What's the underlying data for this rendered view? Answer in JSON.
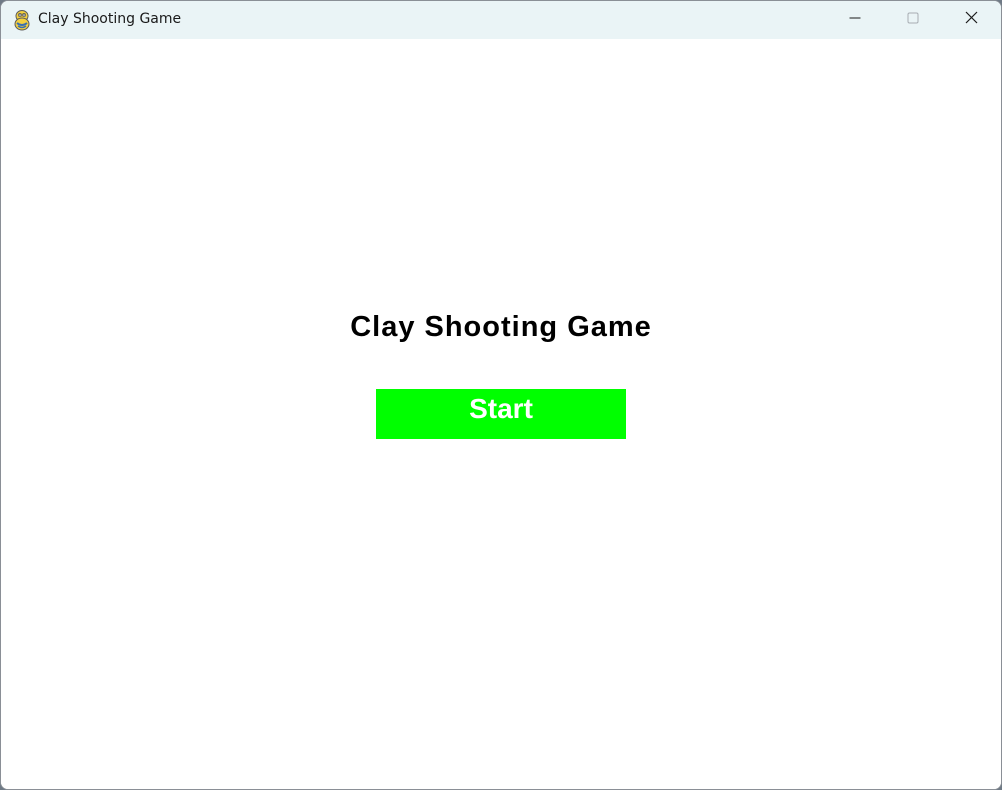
{
  "window": {
    "title": "Clay Shooting Game",
    "icon": "pygame-snake-icon",
    "controls": {
      "minimize_icon": "minimize-icon",
      "maximize_icon": "maximize-icon",
      "close_icon": "close-icon"
    }
  },
  "menu": {
    "title": "Clay Shooting Game",
    "start_label": "Start"
  },
  "colors": {
    "titlebar_bg": "#eaf4f6",
    "content_bg": "#ffffff",
    "start_button_bg": "#00ff00",
    "start_label_color": "#ffffff",
    "title_color": "#000000"
  }
}
